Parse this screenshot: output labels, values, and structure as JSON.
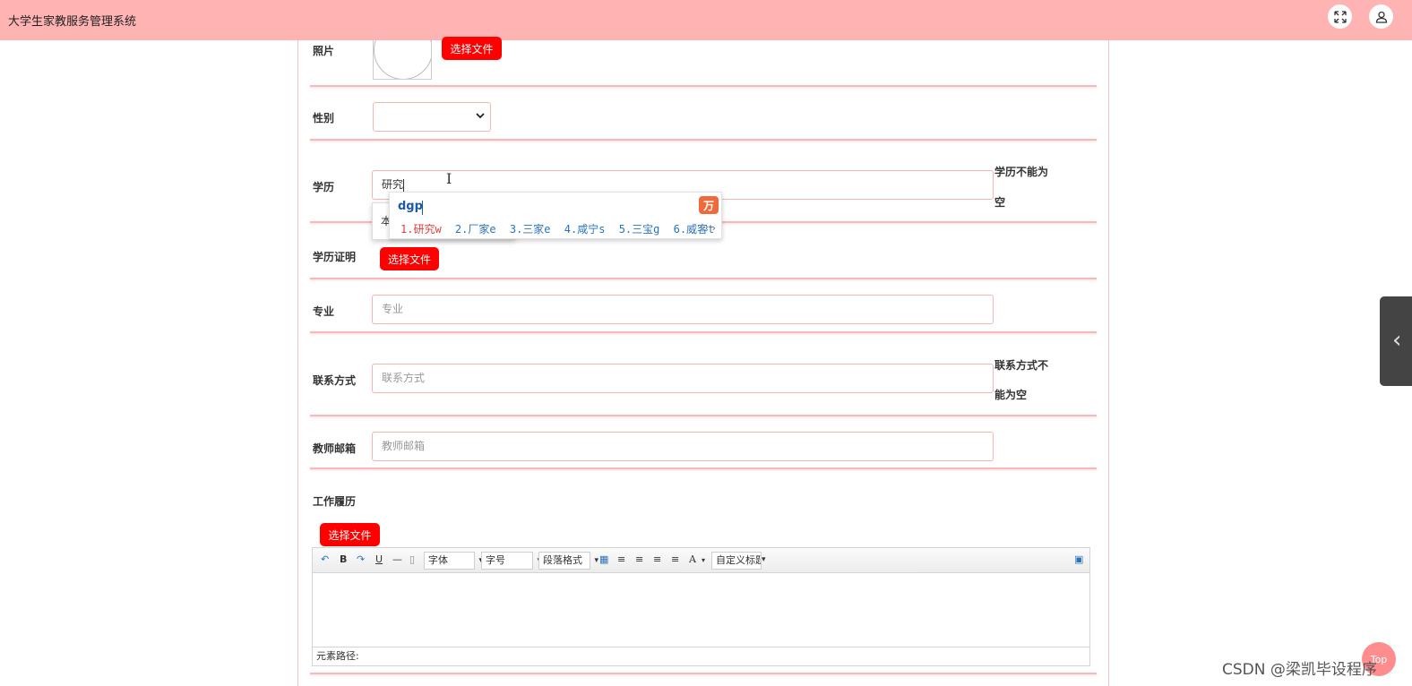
{
  "app": {
    "title": "大学生家教服务管理系统"
  },
  "header": {
    "icons": [
      "fullscreen-icon",
      "user-icon"
    ]
  },
  "form": {
    "photo": {
      "label": "照片",
      "button": "选择文件"
    },
    "gender": {
      "label": "性别",
      "value": ""
    },
    "education": {
      "label": "学历",
      "value": "研究",
      "error_line1": "学历不能为",
      "error_line2": "空",
      "dropdown_item": "本"
    },
    "education_proof": {
      "label": "学历证明",
      "button": "选择文件"
    },
    "major": {
      "label": "专业",
      "placeholder": "专业"
    },
    "contact": {
      "label": "联系方式",
      "placeholder": "联系方式",
      "error_line1": "联系方式不",
      "error_line2": "能为空"
    },
    "email": {
      "label": "教师邮箱",
      "placeholder": "教师邮箱"
    },
    "work_history": {
      "label": "工作履历",
      "button": "选择文件"
    }
  },
  "ime": {
    "composition": "dgp",
    "logo": "万",
    "candidates": [
      "1.研究w",
      "2.厂家e",
      "3.三家e",
      "4.咸宁s",
      "5.三宝g",
      "6.威客t"
    ]
  },
  "editor": {
    "toolbar": {
      "font": "字体",
      "size": "字号",
      "paragraph": "段落格式",
      "custom_title": "自定义标题",
      "bold": "B",
      "underline": "U",
      "font_color": "A"
    },
    "status": "元素路径:"
  },
  "side": {
    "top_button": "Top"
  },
  "watermark": "CSDN @梁凯毕设程序"
}
